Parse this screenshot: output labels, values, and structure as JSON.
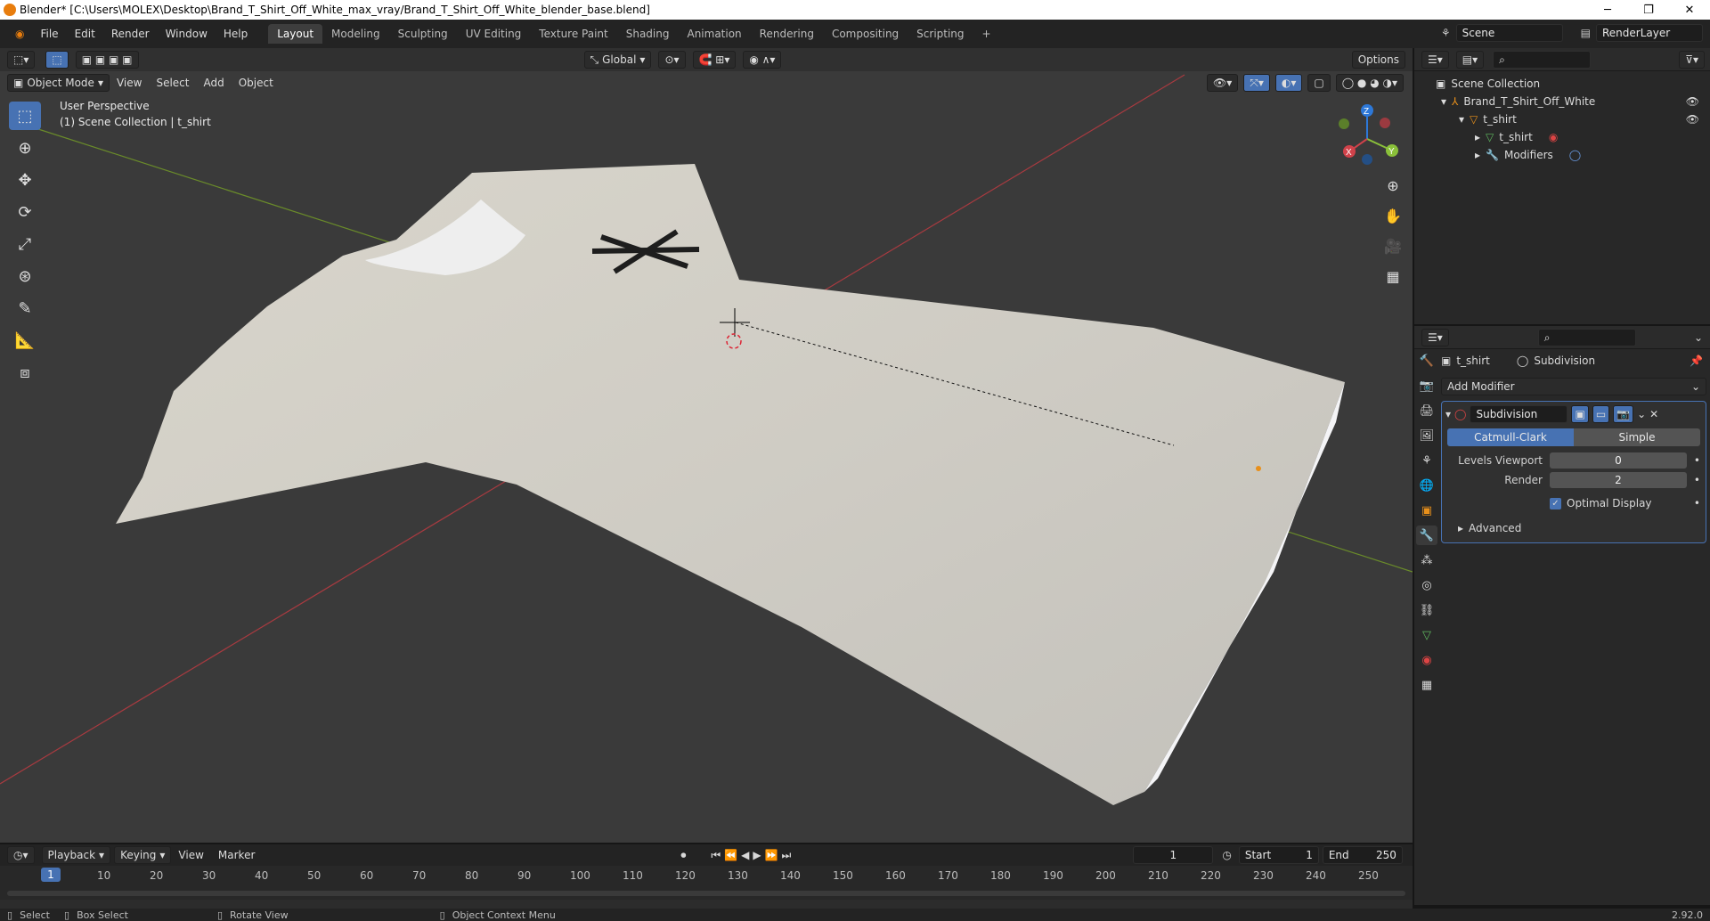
{
  "window": {
    "title": "Blender* [C:\\Users\\MOLEX\\Desktop\\Brand_T_Shirt_Off_White_max_vray/Brand_T_Shirt_Off_White_blender_base.blend]",
    "min": "─",
    "max": "❐",
    "close": "✕"
  },
  "menu": [
    "File",
    "Edit",
    "Render",
    "Window",
    "Help"
  ],
  "workspaces": [
    "Layout",
    "Modeling",
    "Sculpting",
    "UV Editing",
    "Texture Paint",
    "Shading",
    "Animation",
    "Rendering",
    "Compositing",
    "Scripting",
    "+"
  ],
  "scene": {
    "name": "Scene",
    "layer": "RenderLayer"
  },
  "viewport": {
    "transform_orientation": "Global",
    "options": "Options",
    "mode": "Object Mode",
    "menu": [
      "View",
      "Select",
      "Add",
      "Object"
    ],
    "overlay_line1": "User Perspective",
    "overlay_line2": "(1) Scene Collection | t_shirt",
    "gizmo": {
      "x": "X",
      "y": "Y",
      "z": "Z"
    }
  },
  "outliner": {
    "root": "Scene Collection",
    "items": [
      {
        "label": "Brand_T_Shirt_Off_White",
        "depth": 1
      },
      {
        "label": "t_shirt",
        "depth": 2
      },
      {
        "label": "t_shirt",
        "depth": 3
      },
      {
        "label": "Modifiers",
        "depth": 3
      }
    ]
  },
  "properties": {
    "object": "t_shirt",
    "modifier_context": "Subdivision",
    "add_modifier": "Add Modifier",
    "modifier_name": "Subdivision",
    "type_options": [
      "Catmull-Clark",
      "Simple"
    ],
    "levels_viewport_label": "Levels Viewport",
    "levels_viewport": "0",
    "render_label": "Render",
    "render": "2",
    "optimal_display": "Optimal Display",
    "advanced": "Advanced"
  },
  "timeline": {
    "menu": [
      "Playback",
      "Keying",
      "View",
      "Marker"
    ],
    "current_frame": "1",
    "start_label": "Start",
    "start": "1",
    "end_label": "End",
    "end": "250",
    "ticks": [
      "1",
      "10",
      "20",
      "30",
      "40",
      "50",
      "60",
      "70",
      "80",
      "90",
      "100",
      "110",
      "120",
      "130",
      "140",
      "150",
      "160",
      "170",
      "180",
      "190",
      "200",
      "210",
      "220",
      "230",
      "240",
      "250"
    ]
  },
  "status": {
    "select": "Select",
    "box_select": "Box Select",
    "rotate": "Rotate View",
    "context_menu": "Object Context Menu",
    "version": "2.92.0"
  }
}
